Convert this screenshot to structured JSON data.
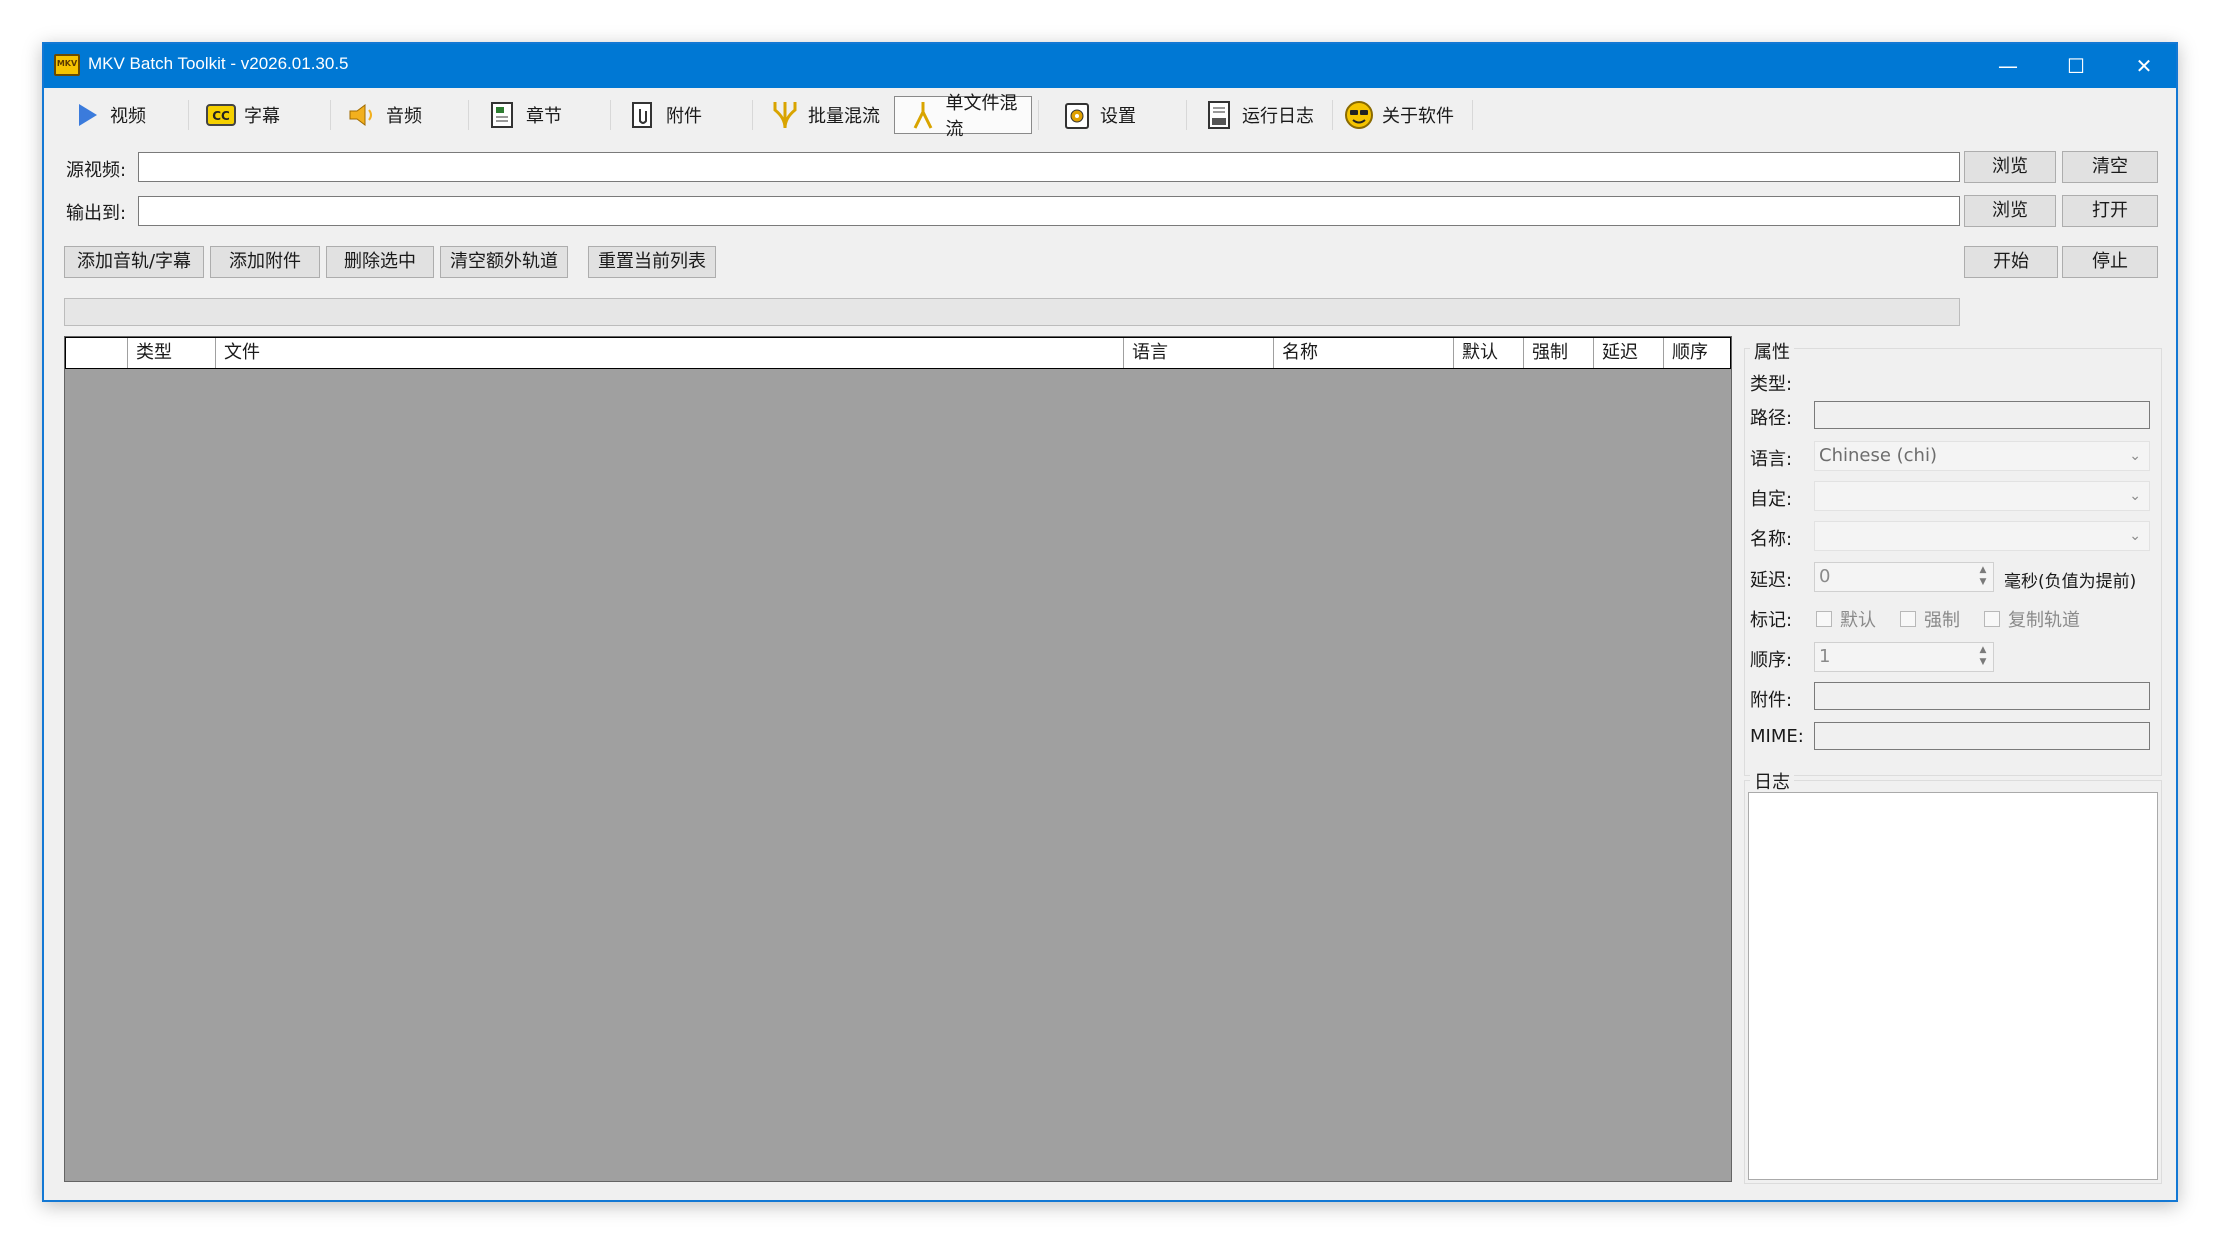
{
  "window": {
    "title": "MKV Batch Toolkit - v2026.01.30.5",
    "app_icon_text": "MKV",
    "controls": {
      "minimize": "—",
      "maximize": "☐",
      "close": "✕"
    }
  },
  "toolbar": {
    "active_tab": "单文件混流",
    "items": [
      {
        "label": "视频",
        "icon": "video-play-icon"
      },
      {
        "label": "字幕",
        "icon": "cc-subtitle-icon"
      },
      {
        "label": "音频",
        "icon": "speaker-icon"
      },
      {
        "label": "章节",
        "icon": "chapter-icon"
      },
      {
        "label": "附件",
        "icon": "attachment-icon"
      },
      {
        "label": "批量混流",
        "icon": "batch-merge-icon"
      },
      {
        "label": "单文件混流",
        "icon": "single-merge-icon"
      },
      {
        "label": "设置",
        "icon": "settings-icon"
      },
      {
        "label": "运行日志",
        "icon": "log-icon"
      },
      {
        "label": "关于软件",
        "icon": "about-icon"
      }
    ]
  },
  "source": {
    "label": "源视频:",
    "value": "",
    "browse": "浏览",
    "clear": "清空"
  },
  "output": {
    "label": "输出到:",
    "value": "",
    "browse": "浏览",
    "open": "打开"
  },
  "actions": {
    "add_track": "添加音轨/字幕",
    "add_attachment": "添加附件",
    "delete_selected": "删除选中",
    "clear_extra": "清空额外轨道",
    "reset_list": "重置当前列表",
    "start": "开始",
    "stop": "停止"
  },
  "progress": {
    "value": 0
  },
  "track_table": {
    "columns": [
      "",
      "类型",
      "文件",
      "语言",
      "名称",
      "默认",
      "强制",
      "延迟",
      "顺序"
    ],
    "rows": []
  },
  "properties": {
    "group_title": "属性",
    "type_label": "类型:",
    "path_label": "路径:",
    "path_value": "",
    "language_label": "语言:",
    "language_value": "Chinese (chi)",
    "custom_label": "自定:",
    "custom_value": "",
    "name_label": "名称:",
    "name_value": "",
    "delay_label": "延迟:",
    "delay_value": "0",
    "delay_hint": "毫秒(负值为提前)",
    "flags_label": "标记:",
    "flag_default": "默认",
    "flag_forced": "强制",
    "flag_copy": "复制轨道",
    "order_label": "顺序:",
    "order_value": "1",
    "attachment_label": "附件:",
    "attachment_value": "",
    "mime_label": "MIME:",
    "mime_value": ""
  },
  "log": {
    "group_title": "日志",
    "content": ""
  },
  "colors": {
    "titlebar": "#0078d4",
    "grid_bg": "#a0a0a0",
    "window_bg": "#f0f0f0"
  }
}
